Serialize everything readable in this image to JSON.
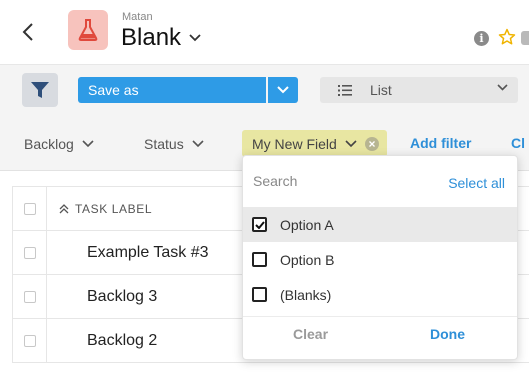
{
  "header": {
    "owner": "Matan",
    "title": "Blank",
    "app_icon": "flask-icon",
    "info_glyph": "i"
  },
  "toolbar": {
    "save_label": "Save as",
    "view_label": "List",
    "view_icon": "list-icon"
  },
  "filters": {
    "chips": [
      {
        "label": "Backlog"
      },
      {
        "label": "Status"
      },
      {
        "label": "My New Field",
        "active": true
      }
    ],
    "add_filter_label": "Add filter",
    "cut_label": "Cl"
  },
  "table": {
    "column_header": "TASK LABEL",
    "rows": [
      "Example Task #3",
      "Backlog 3",
      "Backlog 2"
    ]
  },
  "dropdown": {
    "search_placeholder": "Search",
    "select_all_label": "Select all",
    "options": [
      {
        "label": "Option A",
        "checked": true
      },
      {
        "label": "Option B",
        "checked": false
      },
      {
        "label": "(Blanks)",
        "checked": false
      }
    ],
    "clear_label": "Clear",
    "done_label": "Done"
  },
  "colors": {
    "accent_blue": "#2e9be6",
    "link_blue": "#2e8fd8",
    "active_chip": "#e8e6a2",
    "app_icon_bg": "#f7c3bd",
    "app_icon_fg": "#e0493c",
    "star": "#f0b400"
  }
}
